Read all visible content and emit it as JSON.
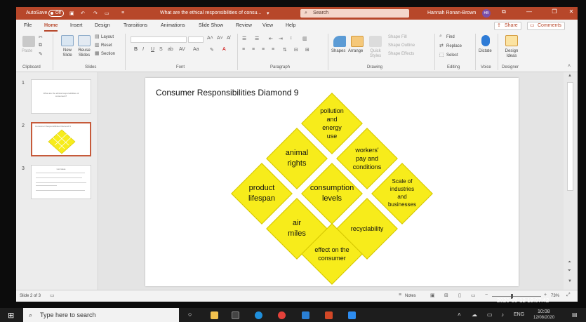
{
  "titlebar": {
    "autosave_label": "AutoSave",
    "autosave_state": "Off",
    "document_title": "What are the ethical responsibilities of consu...",
    "search_placeholder": "Search",
    "user_name": "Hannah Ronan-Brown",
    "user_initials": "HB"
  },
  "tabs": [
    "File",
    "Home",
    "Insert",
    "Design",
    "Transitions",
    "Animations",
    "Slide Show",
    "Review",
    "View",
    "Help"
  ],
  "active_tab": "Home",
  "header_buttons": {
    "share": "Share",
    "comments": "Comments"
  },
  "ribbon": {
    "clipboard": {
      "label": "Clipboard",
      "paste": "Paste"
    },
    "slides": {
      "label": "Slides",
      "new_slide": "New Slide",
      "reuse_slides": "Reuse Slides",
      "layout": "Layout",
      "reset": "Reset",
      "section": "Section"
    },
    "font": {
      "label": "Font",
      "bold": "B",
      "italic": "I",
      "underline": "U",
      "strike": "S"
    },
    "paragraph": {
      "label": "Paragraph"
    },
    "drawing": {
      "label": "Drawing",
      "shapes": "Shapes",
      "arrange": "Arrange",
      "quick_styles": "Quick Styles",
      "shape_fill": "Shape Fill",
      "shape_outline": "Shape Outline",
      "shape_effects": "Shape Effects"
    },
    "editing": {
      "label": "Editing",
      "find": "Find",
      "replace": "Replace",
      "select": "Select"
    },
    "voice": {
      "label": "Voice",
      "dictate": "Dictate"
    },
    "designer": {
      "label": "Designer",
      "design_ideas": "Design Ideas"
    }
  },
  "thumbnails": [
    {
      "number": "1",
      "caption": "What are the ethical responsibilities of consumers?"
    },
    {
      "number": "2",
      "caption": "Consumer Responsibilities Diamond 9"
    },
    {
      "number": "3",
      "caption": "List Ideas"
    }
  ],
  "slide": {
    "title": "Consumer Responsibilities Diamond 9",
    "diamonds": [
      "pollution and energy use",
      "animal rights",
      "workers' pay and conditions",
      "product lifespan",
      "consumption levels",
      "Scale of industries and businesses",
      "air miles",
      "recyclability",
      "effect on the consumer"
    ]
  },
  "statusbar": {
    "slide_info": "Slide 2 of 3",
    "notes": "Notes",
    "zoom": "73%"
  },
  "taskbar": {
    "search_placeholder": "Type here to search",
    "language": "ENG",
    "time": "10:08",
    "date": "12/08/2020"
  },
  "overlay_timestamp": "2020-08-12 19:07:42",
  "colors": {
    "accent": "#b7472a",
    "diamond_fill": "#f7ec1b"
  }
}
